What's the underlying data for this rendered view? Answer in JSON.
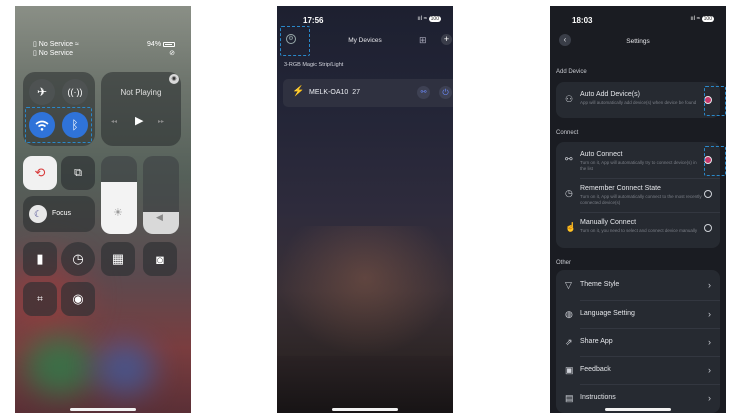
{
  "screen1": {
    "carrier1": "No Service",
    "carrier2": "No Service",
    "battery": "94%",
    "now_playing": "Not Playing",
    "focus_label": "Focus"
  },
  "screen2": {
    "time": "17:56",
    "title": "My Devices",
    "battery": "100",
    "group_label": "3-RGB Magic Strip/Light",
    "device_name": "MELK-OA10",
    "device_num": "27"
  },
  "screen3": {
    "time": "18:03",
    "battery": "100",
    "title": "Settings",
    "sections": {
      "add_device": "Add Device",
      "connect": "Connect",
      "other": "Other"
    },
    "auto_add": {
      "title": "Auto Add Device(s)",
      "desc": "App will automatically add device(s) when device be found"
    },
    "auto_connect": {
      "title": "Auto Connect",
      "desc": "Turn on it, App will automatically try to connect device(s) in the list"
    },
    "remember": {
      "title": "Remember Connect State",
      "desc": "Turn on it, App will automatically connect to the most recently connected device(s)"
    },
    "manual": {
      "title": "Manually Connect",
      "desc": "Turn on it, you need to select and connect device manually"
    },
    "other_items": [
      "Theme Style",
      "Language Setting",
      "Share App",
      "Feedback",
      "Instructions"
    ]
  },
  "colors": {
    "accent_blue": "#2f73d9",
    "highlight_dash": "#2a88c9",
    "radio_on": "#c7376a"
  }
}
